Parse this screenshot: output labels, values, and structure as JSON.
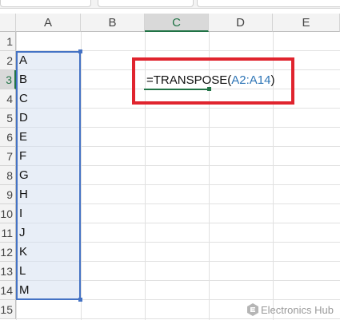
{
  "columns": [
    "A",
    "B",
    "C",
    "D",
    "E"
  ],
  "selected_column": "C",
  "rows": [
    "1",
    "2",
    "3",
    "4",
    "5",
    "6",
    "7",
    "8",
    "9",
    "10",
    "11",
    "12",
    "13",
    "14",
    "15"
  ],
  "selected_row": "3",
  "column_a_values": [
    "A",
    "B",
    "C",
    "D",
    "E",
    "F",
    "G",
    "H",
    "I",
    "J",
    "K",
    "L",
    "M"
  ],
  "formula": {
    "prefix": "=TRANSPOSE(",
    "range": "A2:A14",
    "suffix": ")"
  },
  "watermark": {
    "brand": "Electronics Hub",
    "icon": "electronics-hub-logo"
  },
  "colors": {
    "active_green": "#217346",
    "selection_blue": "#4472c4",
    "highlight_red": "#e0242e",
    "range_ref_blue": "#2e75b6"
  }
}
